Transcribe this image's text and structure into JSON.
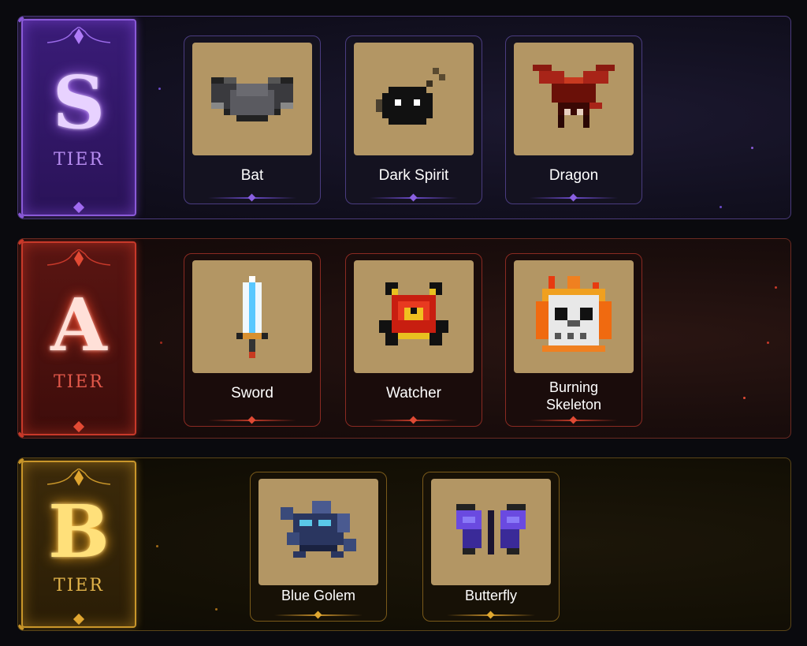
{
  "tiers": [
    {
      "letter": "S",
      "label": "TIER",
      "color": "#8a5ad8",
      "items": [
        {
          "name": "Bat",
          "icon": "bat-icon"
        },
        {
          "name": "Dark Spirit",
          "icon": "dark-spirit-icon"
        },
        {
          "name": "Dragon",
          "icon": "dragon-icon"
        }
      ]
    },
    {
      "letter": "A",
      "label": "TIER",
      "color": "#c8392a",
      "items": [
        {
          "name": "Sword",
          "icon": "sword-icon"
        },
        {
          "name": "Watcher",
          "icon": "watcher-icon"
        },
        {
          "name": "Burning Skeleton",
          "icon": "burning-skeleton-icon"
        }
      ]
    },
    {
      "letter": "B",
      "label": "TIER",
      "color": "#c9962a",
      "items": [
        {
          "name": "Blue Golem",
          "icon": "blue-golem-icon"
        },
        {
          "name": "Butterfly",
          "icon": "butterfly-icon"
        }
      ]
    }
  ]
}
